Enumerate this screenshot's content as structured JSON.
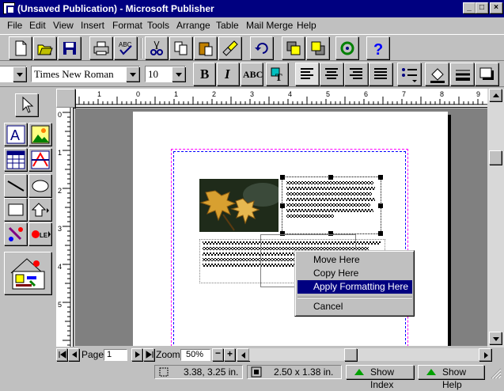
{
  "window": {
    "title": "(Unsaved Publication) - Microsoft Publisher"
  },
  "menu": [
    "File",
    "Edit",
    "View",
    "Insert",
    "Format",
    "Tools",
    "Arrange",
    "Table",
    "Mail Merge",
    "Help"
  ],
  "format_bar": {
    "font_name": "Times New Roman",
    "font_size": "10",
    "bold": "B",
    "italic": "I",
    "small_caps": "ABC"
  },
  "ruler_h_labels": [
    "1",
    "0",
    "1",
    "2",
    "3",
    "4",
    "5",
    "6",
    "7",
    "8",
    "9"
  ],
  "ruler_v_labels": [
    "0",
    "1",
    "2",
    "3",
    "4",
    "5"
  ],
  "context_menu": {
    "items": [
      "Move Here",
      "Copy Here",
      "Apply Formatting Here",
      "Cancel"
    ],
    "selected": "Apply Formatting Here"
  },
  "nav": {
    "page_label": "Page",
    "page_number": "1",
    "zoom_label": "Zoom",
    "zoom_value": "50%"
  },
  "status": {
    "position": "3.38, 3.25 in.",
    "size": "2.50 x  1.38 in.",
    "show_index": "Show Index",
    "show_help": "Show Help"
  }
}
